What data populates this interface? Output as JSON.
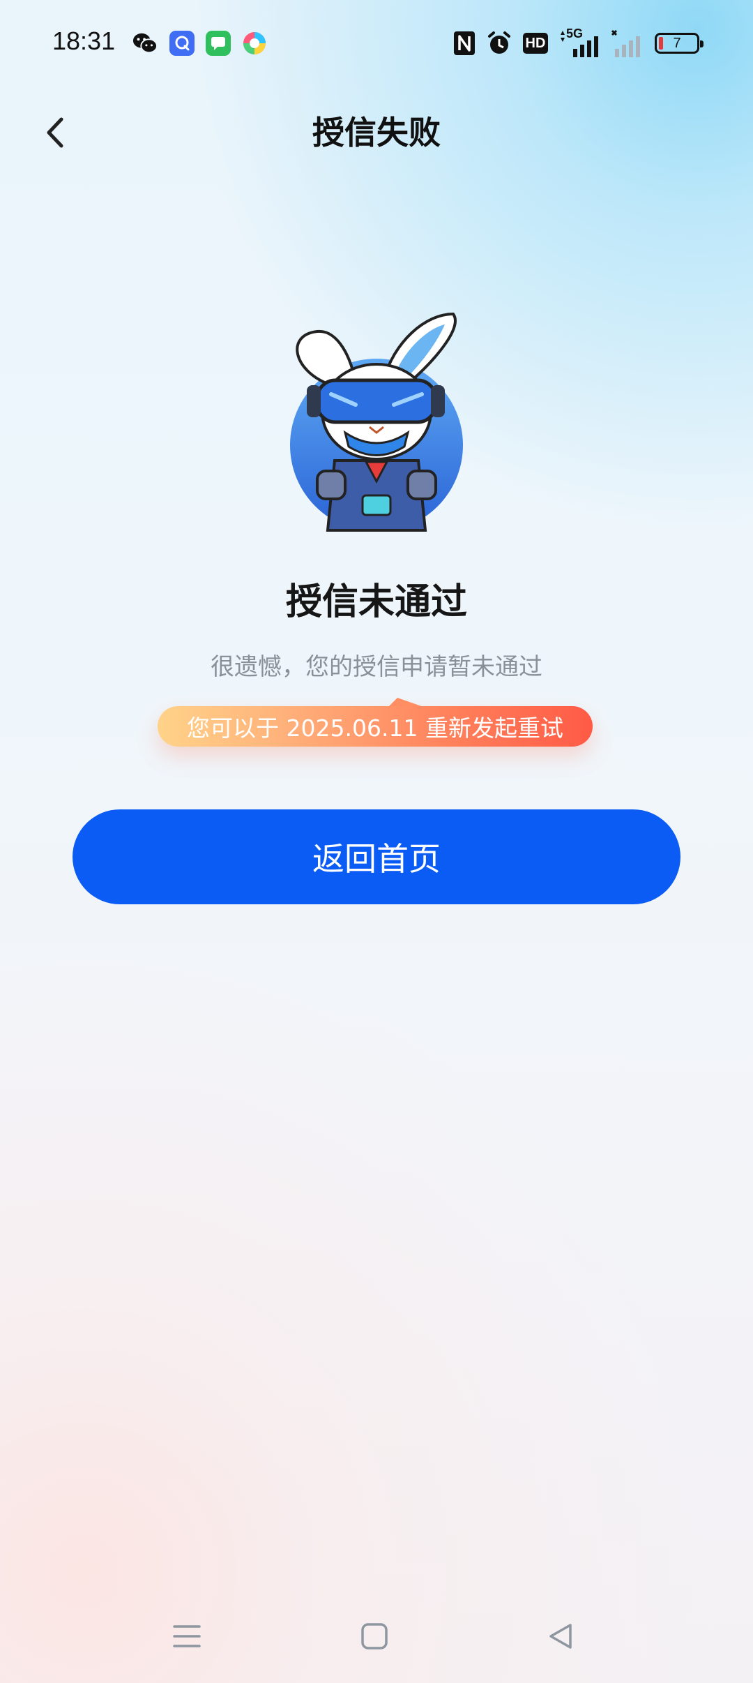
{
  "status_bar": {
    "time": "18:31",
    "apps": [
      "wechat-icon",
      "qq-icon",
      "messages-icon",
      "browser-icon"
    ],
    "hd_label": "HD",
    "network": "5G",
    "battery": "7"
  },
  "header": {
    "title": "授信失败"
  },
  "result": {
    "title": "授信未通过",
    "subtitle": "很遗憾，您的授信申请暂未通过",
    "retry_notice": "您可以于 2025.06.11 重新发起重试"
  },
  "actions": {
    "home_button": "返回首页"
  },
  "colors": {
    "primary": "#0a5cf5",
    "pill_start": "#ffd389",
    "pill_end": "#ff5a45",
    "title": "#161616",
    "subtitle": "#8a8f98"
  }
}
